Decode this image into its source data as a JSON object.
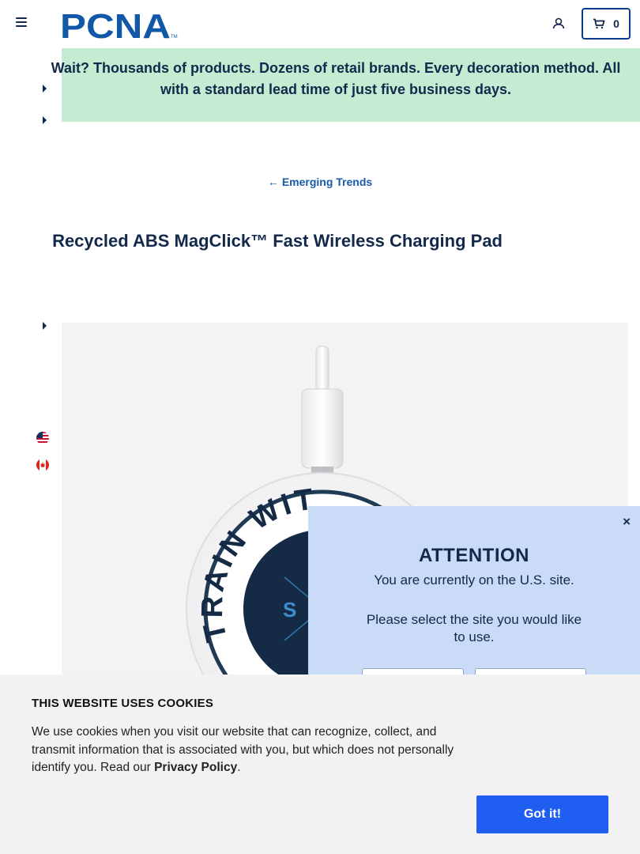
{
  "header": {
    "menu_icon": "hamburger-icon",
    "logo_text": "PCNA",
    "account_icon": "user-icon",
    "cart_icon": "cart-icon",
    "cart_count": "0"
  },
  "banner": {
    "line1": "Wait? Thousands of products. Dozens of retail brands. Every decoration method. All",
    "line2": "with a standard lead time of just five business days.",
    "background": "#c3ecd3"
  },
  "breadcrumb": {
    "back_label": "Emerging Trends"
  },
  "product": {
    "title": "Recycled ABS MagClick™ Fast Wireless Charging Pad"
  },
  "region_flags": [
    "us-flag-icon",
    "canada-flag-icon"
  ],
  "modal": {
    "title": "ATTENTION",
    "text1": "You are currently on the U.S. site.",
    "text2": "Please select the site you would like to use.",
    "close_symbol": "×",
    "background": "#c9dbf6"
  },
  "cookie": {
    "title": "THIS WEBSITE USES COOKIES",
    "text_before": "We use cookies when you visit our website that can recognize, collect, and transmit information that is associated with you, but which does not personally identify you. Read our ",
    "link": "Privacy Policy",
    "text_after": ".",
    "button": "Got it!",
    "button_color": "#1f5ef0"
  },
  "colors": {
    "brand_navy": "#13294b",
    "link_blue": "#1a5aa8"
  }
}
